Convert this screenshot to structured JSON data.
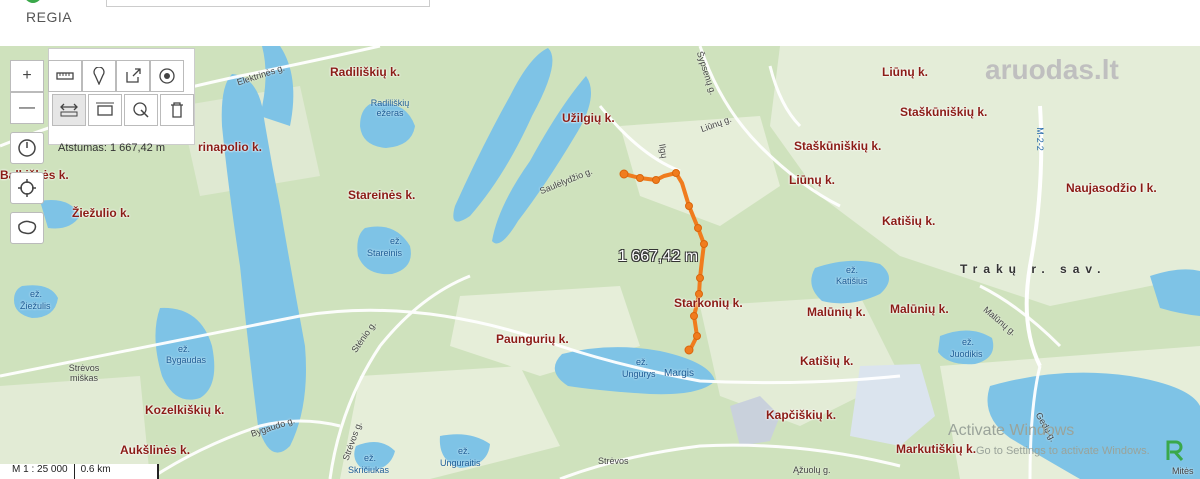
{
  "header": {
    "brand": "REGIA"
  },
  "toolbar": {
    "zoom_in": "+",
    "zoom_out": "—",
    "distance_label": "Atstumas: 1 667,42 m"
  },
  "map": {
    "measure_label": "1 667,42 m",
    "villages": {
      "radiliskiu": "Radiliškių k.",
      "liunu_top": "Liūnų k.",
      "uzilgiu": "Užilgių k.",
      "staskuniskiu1": "Staškūniškių k.",
      "staskuniskiu2": "Staškūniškių k.",
      "rinapolio": "rinapolio k.",
      "alkiskes": "Balkiškės k.",
      "liunu_mid": "Liūnų k.",
      "naujasodzio": "Naujasodžio I k.",
      "stareines": "Stareinės k.",
      "ziezulio": "Žiežulio k.",
      "katisiu_top": "Katišių k.",
      "starkoniu": "Starkonių k.",
      "maluniu1": "Malūnių k.",
      "maluniu2": "Malūnių k.",
      "pauguriu": "Paungurių k.",
      "katisiu_low": "Katišių k.",
      "kozelkiskiu": "Kozelkiškių k.",
      "kapciskiu": "Kapčiškių k.",
      "auksilines": "Aukšlinės k.",
      "markutiskiu": "Markutiškių k."
    },
    "lakes": {
      "radiliskiu": "Radiliškių ežeras",
      "stareinis_ez": "ež.",
      "stareinis": "Stareinis",
      "ziezulis_ez": "ež.",
      "ziezulis": "Žiežulis",
      "bygaudas_ez": "ež.",
      "bygaudas": "Bygaudas",
      "katisius_ez": "ež.",
      "katisius": "Katišius",
      "juodikis_ez": "ež.",
      "juodikis": "Juodikis",
      "ungurys_ez": "ež.",
      "ungurys": "Ungurys",
      "margis": "Margis",
      "skriciukas_ez": "ež.",
      "skriciukas": "Skričiukas",
      "ungurai_ez": "ež.",
      "unguraitis": "Unguraitis"
    },
    "roads": {
      "elektrines": "Elektrinės g.",
      "sypseny": "Šypsenų g.",
      "liunu_g": "Liūnų g.",
      "ilgu": "Ilgų",
      "saulelydzio": "Saulėlydžio g.",
      "stenio": "Stėnio g.",
      "strevos_miskas": "Strėvos miškas",
      "bygaudo": "Bygaudo g.",
      "strevos_g": "Strėvos g.",
      "malunu_g": "Malūnų g.",
      "strevos": "Strėvos",
      "azuolu": "Ąžuolų g.",
      "gedu": "Gedų g.",
      "m22": "M-2-2",
      "mites": "Mitės"
    },
    "region": "Trakų r. sav."
  },
  "scale": {
    "ratio": "M 1 : 25 000",
    "length": "0.6 km"
  },
  "watermark": "aruodas.lt",
  "os_notice": {
    "title": "Activate Windows",
    "sub": "Go to Settings to activate Windows."
  },
  "colors": {
    "route": "#f07c1e",
    "water": "#7ec3e6",
    "forest": "#c5dcb2",
    "field": "#e5eedb",
    "village_text": "#8b1c16"
  }
}
